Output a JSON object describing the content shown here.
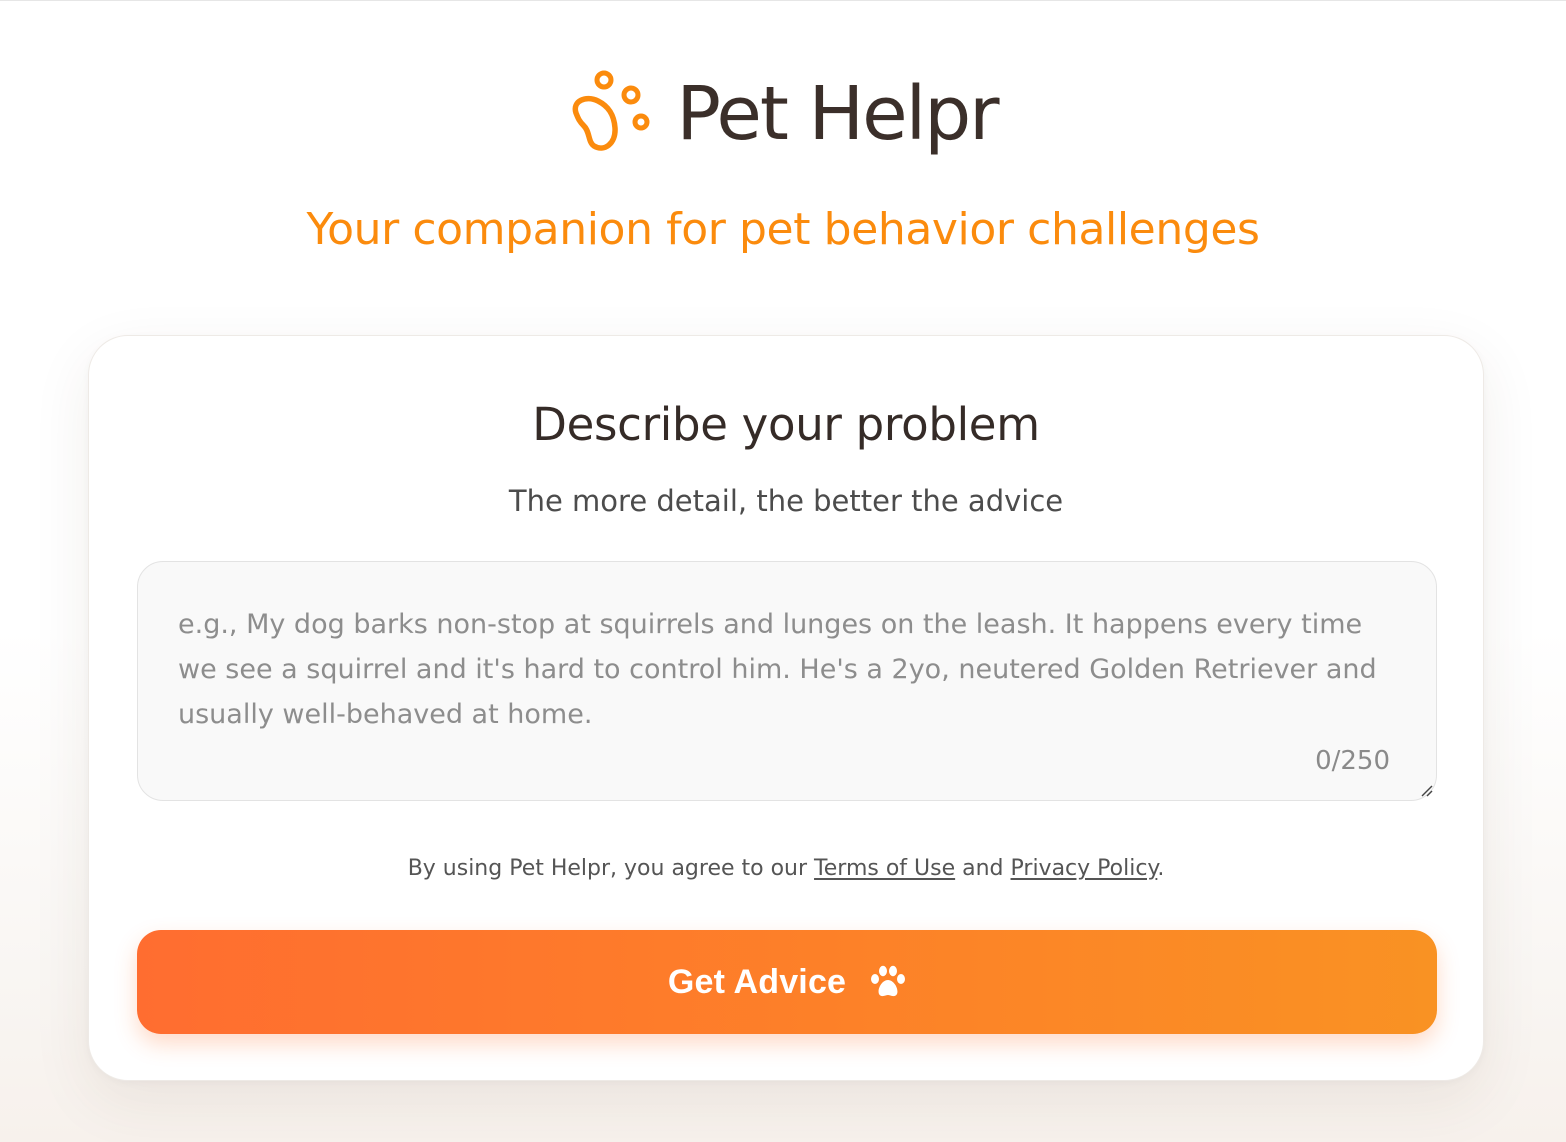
{
  "app": {
    "brand": "Pet Helpr",
    "tagline": "Your companion for pet behavior challenges",
    "logo_icon": "paw-logo-icon",
    "accent_color": "#fb8b0d"
  },
  "form": {
    "title": "Describe your problem",
    "subtitle": "The more detail, the better the advice",
    "input": {
      "value": "",
      "placeholder": "e.g., My dog barks non-stop at squirrels and lunges on the leash. It happens every time we see a squirrel and it's hard to control him. He's a 2yo, neutered Golden Retriever and usually well-behaved at home.",
      "char_count": "0/250"
    },
    "legal": {
      "prefix": "By using Pet Helpr, you agree to our ",
      "terms_label": "Terms of Use",
      "middle": " and ",
      "privacy_label": "Privacy Policy",
      "suffix": "."
    },
    "submit": {
      "label": "Get Advice",
      "icon": "paw-icon",
      "gradient_start": "#ff6d30",
      "gradient_end": "#f99223"
    }
  }
}
